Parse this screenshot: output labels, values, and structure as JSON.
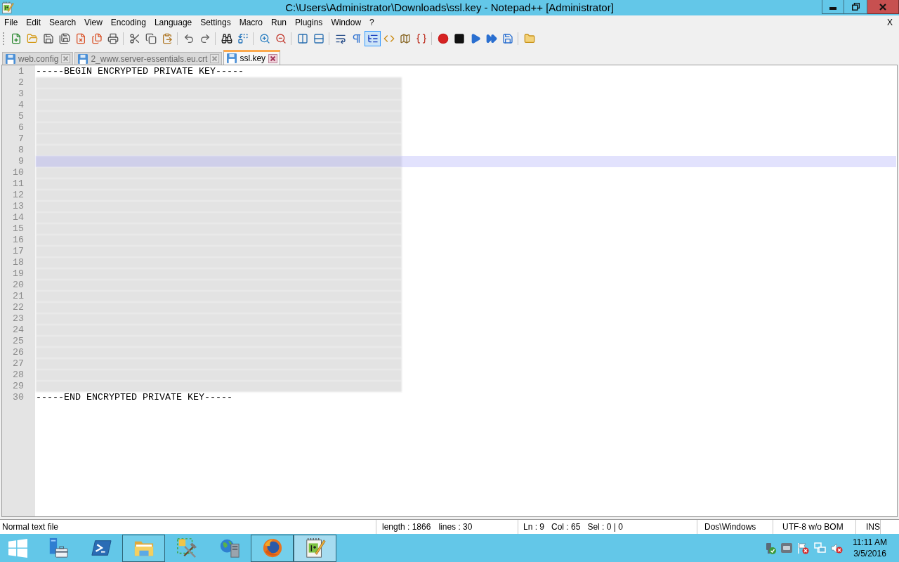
{
  "window": {
    "title": "C:\\Users\\Administrator\\Downloads\\ssl.key - Notepad++ [Administrator]"
  },
  "menu": {
    "items": [
      "File",
      "Edit",
      "Search",
      "View",
      "Encoding",
      "Language",
      "Settings",
      "Macro",
      "Run",
      "Plugins",
      "Window",
      "?"
    ],
    "close": "X"
  },
  "toolbar": [
    {
      "kind": "button",
      "pressed": false
    },
    {
      "kind": "button",
      "pressed": false
    },
    {
      "kind": "button",
      "pressed": false
    },
    {
      "kind": "button",
      "pressed": false
    },
    {
      "kind": "button",
      "pressed": false
    },
    {
      "kind": "button",
      "pressed": false
    },
    {
      "kind": "button",
      "pressed": false
    },
    {
      "kind": "separator"
    },
    {
      "kind": "button",
      "pressed": false
    },
    {
      "kind": "button",
      "pressed": false
    },
    {
      "kind": "button",
      "pressed": false
    },
    {
      "kind": "separator"
    },
    {
      "kind": "button",
      "pressed": false
    },
    {
      "kind": "button",
      "pressed": false
    },
    {
      "kind": "separator"
    },
    {
      "kind": "button",
      "pressed": false
    },
    {
      "kind": "button",
      "pressed": false
    },
    {
      "kind": "separator"
    },
    {
      "kind": "button",
      "pressed": false
    },
    {
      "kind": "button",
      "pressed": false
    },
    {
      "kind": "separator"
    },
    {
      "kind": "button",
      "pressed": false
    },
    {
      "kind": "button",
      "pressed": false
    },
    {
      "kind": "separator"
    },
    {
      "kind": "button",
      "pressed": false
    },
    {
      "kind": "button",
      "pressed": false
    },
    {
      "kind": "button",
      "pressed": true
    },
    {
      "kind": "button",
      "pressed": false
    },
    {
      "kind": "button",
      "pressed": false
    },
    {
      "kind": "button",
      "pressed": false
    },
    {
      "kind": "separator"
    },
    {
      "kind": "button",
      "pressed": false
    },
    {
      "kind": "button",
      "pressed": false
    },
    {
      "kind": "button",
      "pressed": false
    },
    {
      "kind": "button",
      "pressed": false
    },
    {
      "kind": "button",
      "pressed": false
    },
    {
      "kind": "separator"
    },
    {
      "kind": "button",
      "pressed": false
    }
  ],
  "tabs": [
    {
      "label": "web.config",
      "selected": false
    },
    {
      "label": "2_www.server-essentials.eu.crt",
      "selected": false
    },
    {
      "label": "ssl.key",
      "selected": true
    }
  ],
  "editor": {
    "lines": [
      {
        "number": "1",
        "text": "-----BEGIN ENCRYPTED PRIVATE KEY-----",
        "redacted": false,
        "current": false
      },
      {
        "number": "2",
        "redacted": true,
        "current": false
      },
      {
        "number": "3",
        "redacted": true,
        "current": false
      },
      {
        "number": "4",
        "redacted": true,
        "current": false
      },
      {
        "number": "5",
        "redacted": true,
        "current": false
      },
      {
        "number": "6",
        "redacted": true,
        "current": false
      },
      {
        "number": "7",
        "redacted": true,
        "current": false
      },
      {
        "number": "8",
        "redacted": true,
        "current": false
      },
      {
        "number": "9",
        "redacted": true,
        "current": true
      },
      {
        "number": "10",
        "redacted": true,
        "current": false
      },
      {
        "number": "11",
        "redacted": true,
        "current": false
      },
      {
        "number": "12",
        "redacted": true,
        "current": false
      },
      {
        "number": "13",
        "redacted": true,
        "current": false
      },
      {
        "number": "14",
        "redacted": true,
        "current": false
      },
      {
        "number": "15",
        "redacted": true,
        "current": false
      },
      {
        "number": "16",
        "redacted": true,
        "current": false
      },
      {
        "number": "17",
        "redacted": true,
        "current": false
      },
      {
        "number": "18",
        "redacted": true,
        "current": false
      },
      {
        "number": "19",
        "redacted": true,
        "current": false
      },
      {
        "number": "20",
        "redacted": true,
        "current": false
      },
      {
        "number": "21",
        "redacted": true,
        "current": false
      },
      {
        "number": "22",
        "redacted": true,
        "current": false
      },
      {
        "number": "23",
        "redacted": true,
        "current": false
      },
      {
        "number": "24",
        "redacted": true,
        "current": false
      },
      {
        "number": "25",
        "redacted": true,
        "current": false
      },
      {
        "number": "26",
        "redacted": true,
        "current": false
      },
      {
        "number": "27",
        "redacted": true,
        "current": false
      },
      {
        "number": "28",
        "redacted": true,
        "current": false
      },
      {
        "number": "29",
        "redacted": true,
        "current": false
      },
      {
        "number": "30",
        "text": "-----END ENCRYPTED PRIVATE KEY-----",
        "redacted": false,
        "current": false
      }
    ]
  },
  "status_bar": {
    "file_type": "Normal text file",
    "length": "length : 1866",
    "lines": "lines : 30",
    "line": "Ln : 9",
    "column": "Col : 65",
    "selection": "Sel : 0 | 0",
    "eol": "Dos\\Windows",
    "encoding": "UTF-8 w/o BOM",
    "mode": "INS"
  },
  "taskbar": {
    "items": [
      {
        "running": false,
        "active": false
      },
      {
        "running": false,
        "active": false
      },
      {
        "running": true,
        "active": false
      },
      {
        "running": false,
        "active": false
      },
      {
        "running": false,
        "active": false
      },
      {
        "running": true,
        "active": false
      },
      {
        "running": true,
        "active": true
      }
    ],
    "clock": {
      "time": "11:11 AM",
      "date": "3/5/2016"
    }
  }
}
